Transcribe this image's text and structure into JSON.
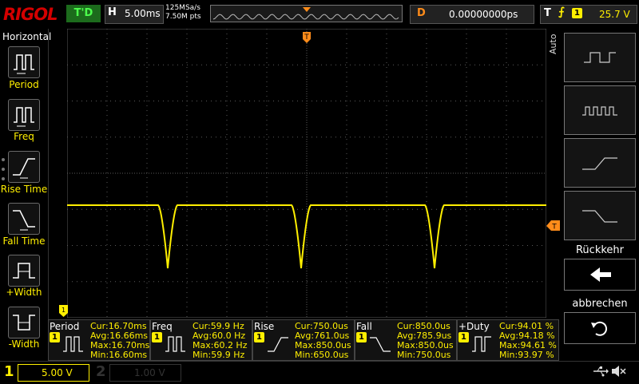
{
  "topbar": {
    "brand": "RIGOL",
    "run_status": "T'D",
    "horizontal_letter": "H",
    "timebase": "5.00ms",
    "sample_rate": "125MSa/s",
    "memory_depth": "7.50M pts",
    "delay_letter": "D",
    "delay_value": "0.00000000ps",
    "trigger_letter": "T",
    "trigger_edge_icon": "rising-edge-icon",
    "trigger_channel": "1",
    "trigger_level": "25.7 V"
  },
  "left_menu": {
    "title": "Horizontal",
    "items": [
      {
        "label": "Period",
        "icon": "period-icon"
      },
      {
        "label": "Freq",
        "icon": "frequency-icon"
      },
      {
        "label": "Rise Time",
        "icon": "rise-time-icon"
      },
      {
        "label": "Fall Time",
        "icon": "fall-time-icon"
      },
      {
        "label": "+Width",
        "icon": "positive-width-icon"
      },
      {
        "label": "-Width",
        "icon": "negative-width-icon"
      }
    ]
  },
  "right_menu": {
    "mode_label": "Auto",
    "back_label": "Rückkehr",
    "cancel_label": "abbrechen"
  },
  "markers": {
    "trigger_position": "T",
    "trigger_level": "T",
    "channel_ground": "1"
  },
  "measurements": [
    {
      "title": "Period",
      "channel": "1",
      "cur": "Cur:16.70ms",
      "avg": "Avg:16.66ms",
      "max": "Max:16.70ms",
      "min": "Min:16.60ms"
    },
    {
      "title": "Freq",
      "channel": "1",
      "cur": "Cur:59.9 Hz",
      "avg": "Avg:60.0 Hz",
      "max": "Max:60.2 Hz",
      "min": "Min:59.9 Hz"
    },
    {
      "title": "Rise",
      "channel": "1",
      "cur": "Cur:750.0us",
      "avg": "Avg:761.0us",
      "max": "Max:850.0us",
      "min": "Min:650.0us"
    },
    {
      "title": "Fall",
      "channel": "1",
      "cur": "Cur:850.0us",
      "avg": "Avg:785.9us",
      "max": "Max:850.0us",
      "min": "Min:750.0us"
    },
    {
      "title": "+Duty",
      "channel": "1",
      "cur": "Cur:94.01 %",
      "avg": "Avg:94.18 %",
      "max": "Max:94.61 %",
      "min": "Min:93.97 %"
    }
  ],
  "channels": [
    {
      "number": "1",
      "scale": "5.00 V"
    },
    {
      "number": "2",
      "scale": "1.00 V"
    }
  ],
  "colors": {
    "ch1": "#ffef00",
    "brand": "#d40000",
    "run": "#4cff4c",
    "trigger_marker": "#ff8c1a",
    "grid": "#5a5a5a"
  },
  "status_icons": [
    "usb-icon",
    "speaker-muted-icon"
  ]
}
